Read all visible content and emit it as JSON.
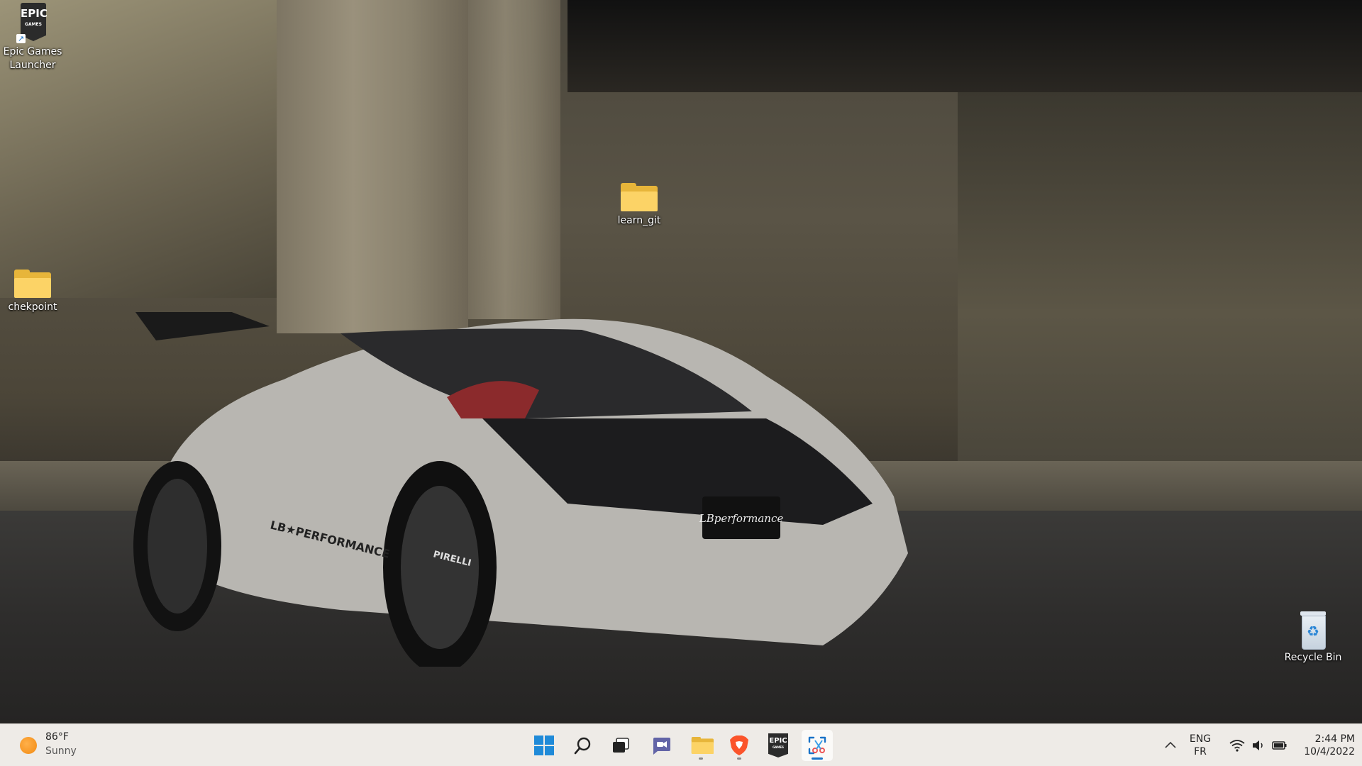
{
  "desktop": {
    "icons": [
      {
        "label_line1": "Epic Games",
        "label_line2": "Launcher",
        "logo_top": "EPIC",
        "logo_bottom": "GAMES"
      },
      {
        "label": "learn_git"
      },
      {
        "label": "chekpoint"
      },
      {
        "label": "Recycle Bin"
      }
    ]
  },
  "wallpaper": {
    "plate_text": "LBperformance",
    "side_text": "LB★PERFORMANCE",
    "tire_text": "PIRELLI"
  },
  "taskbar": {
    "weather": {
      "temp": "86°F",
      "condition": "Sunny",
      "icon": "sun-icon"
    },
    "apps": [
      {
        "name": "start-button",
        "icon": "windows-logo-icon"
      },
      {
        "name": "search-button",
        "icon": "search-icon"
      },
      {
        "name": "task-view-button",
        "icon": "task-view-icon"
      },
      {
        "name": "teams-chat-button",
        "icon": "chat-icon"
      },
      {
        "name": "file-explorer-button",
        "icon": "folder-icon"
      },
      {
        "name": "brave-browser-button",
        "icon": "brave-lion-icon"
      },
      {
        "name": "epic-games-button",
        "icon": "epic-games-icon",
        "logo_top": "EPIC",
        "logo_bottom": "GAMES"
      },
      {
        "name": "snipping-tool-button",
        "icon": "snipping-tool-icon"
      }
    ],
    "tray": {
      "lang_top": "ENG",
      "lang_bottom": "FR",
      "time": "2:44 PM",
      "date": "10/4/2022"
    },
    "colors": {
      "accent": "#1a73c8",
      "taskbar_bg": "#eeebe7"
    }
  }
}
